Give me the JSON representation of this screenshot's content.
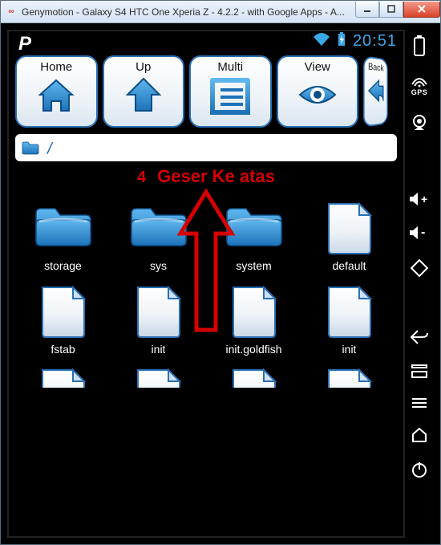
{
  "window": {
    "title": "Genymotion - Galaxy S4  HTC One  Xperia Z - 4.2.2 - with Google Apps - A..."
  },
  "statusbar": {
    "time": "20:51"
  },
  "toolbar": {
    "home": "Home",
    "up": "Up",
    "multi": "Multi",
    "view": "View",
    "back": "Back"
  },
  "pathbar": {
    "path": "/"
  },
  "annotation": {
    "number": "4",
    "text": "Geser Ke atas"
  },
  "sidebar": {
    "gps_label": "GPS"
  },
  "files": [
    {
      "name": "storage",
      "type": "folder"
    },
    {
      "name": "sys",
      "type": "folder"
    },
    {
      "name": "system",
      "type": "folder"
    },
    {
      "name": "default",
      "type": "file"
    },
    {
      "name": "fstab",
      "type": "file"
    },
    {
      "name": "init",
      "type": "file"
    },
    {
      "name": "init.goldfish",
      "type": "file"
    },
    {
      "name": "init",
      "type": "file"
    },
    {
      "name": "",
      "type": "file",
      "cropped": true
    },
    {
      "name": "",
      "type": "file",
      "cropped": true
    },
    {
      "name": "",
      "type": "file",
      "cropped": true
    },
    {
      "name": "",
      "type": "file",
      "cropped": true
    }
  ]
}
